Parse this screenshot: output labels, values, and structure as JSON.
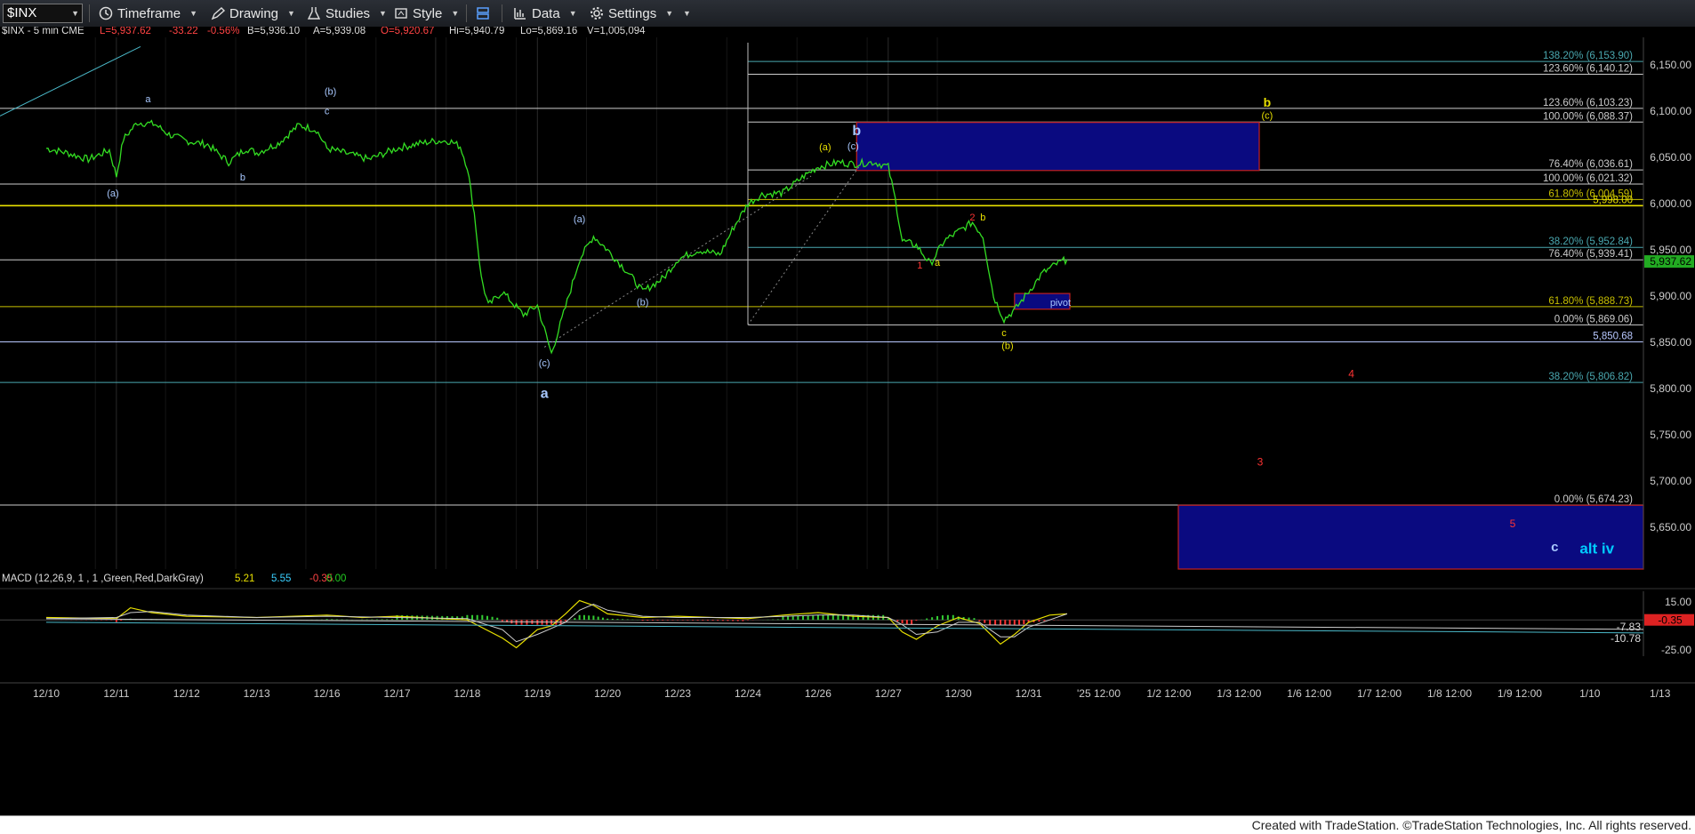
{
  "toolbar": {
    "symbol": "$INX",
    "timeframe": "Timeframe",
    "drawing": "Drawing",
    "studies": "Studies",
    "style": "Style",
    "data": "Data",
    "settings": "Settings"
  },
  "header": {
    "symbol_info": "$INX - 5 min  CME",
    "last": "L=5,937.62",
    "change": "-33.22",
    "change_pct": "-0.56%",
    "bid": "B=5,936.10",
    "ask": "A=5,939.08",
    "open": "O=5,920.67",
    "high": "Hi=5,940.79",
    "low": "Lo=5,869.16",
    "volume": "V=1,005,094"
  },
  "macd_header": {
    "label": "MACD (12,26,9, 1 , 1 ,Green,Red,DarkGray)",
    "v1": "5.21",
    "v2": "5.55",
    "v3": "-0.35",
    "v4": "0.00"
  },
  "footer": "Created with TradeStation. ©TradeStation Technologies, Inc. All rights reserved.",
  "colors": {
    "price_line": "#33dd22",
    "positive": "#33cc33",
    "negative": "#ff3333",
    "fib_yellow": "#e8e000",
    "wave_blue": "#a8c8ff",
    "box_blue": "#0a0a80",
    "box_border": "#c02020",
    "current_price_bg": "#22aa22"
  },
  "chart_data": {
    "type": "line",
    "title": "$INX - 5 min",
    "ylim": [
      5605,
      6180
    ],
    "y_ticks": [
      "6,150.00",
      "6,100.00",
      "6,050.00",
      "6,000.00",
      "5,950.00",
      "5,900.00",
      "5,850.00",
      "5,800.00",
      "5,750.00",
      "5,700.00",
      "5,650.00"
    ],
    "y_tick_values": [
      6150,
      6100,
      6050,
      6000,
      5950,
      5900,
      5850,
      5800,
      5750,
      5700,
      5650
    ],
    "x_ticks": [
      "12/10",
      "12/11",
      "12/12",
      "12/13",
      "12/16",
      "12/17",
      "12/18",
      "12/19",
      "12/20",
      "12/23",
      "12/24",
      "12/26",
      "12/27",
      "12/30",
      "12/31",
      "'25 12:00",
      "1/2 12:00",
      "1/3 12:00",
      "1/6 12:00",
      "1/7 12:00",
      "1/8 12:00",
      "1/9 12:00",
      "1/10",
      "1/13"
    ],
    "current_price": "5,937.62",
    "series": [
      {
        "values": [
          [
            0,
            6060
          ],
          [
            0.3,
            6055
          ],
          [
            0.6,
            6048
          ],
          [
            0.9,
            6058
          ],
          [
            1,
            6030
          ],
          [
            1.1,
            6070
          ],
          [
            1.3,
            6088
          ],
          [
            1.55,
            6086
          ],
          [
            1.75,
            6075
          ],
          [
            2,
            6068
          ],
          [
            2.3,
            6064
          ],
          [
            2.6,
            6045
          ],
          [
            2.85,
            6060
          ],
          [
            3,
            6055
          ],
          [
            3.3,
            6065
          ],
          [
            3.6,
            6085
          ],
          [
            3.85,
            6080
          ],
          [
            4,
            6060
          ],
          [
            4.3,
            6054
          ],
          [
            4.6,
            6048
          ],
          [
            5,
            6060
          ],
          [
            5.3,
            6065
          ],
          [
            5.55,
            6068
          ],
          [
            5.75,
            6068
          ],
          [
            5.9,
            6062
          ],
          [
            6,
            6040
          ],
          [
            6.1,
            5990
          ],
          [
            6.2,
            5920
          ],
          [
            6.3,
            5890
          ],
          [
            6.5,
            5905
          ],
          [
            6.8,
            5880
          ],
          [
            7,
            5890
          ],
          [
            7.2,
            5838
          ],
          [
            7.4,
            5888
          ],
          [
            7.6,
            5940
          ],
          [
            7.8,
            5965
          ],
          [
            8,
            5950
          ],
          [
            8.3,
            5925
          ],
          [
            8.5,
            5905
          ],
          [
            8.8,
            5920
          ],
          [
            9,
            5940
          ],
          [
            9.3,
            5950
          ],
          [
            9.6,
            5945
          ],
          [
            9.8,
            5975
          ],
          [
            10,
            6000
          ],
          [
            10.2,
            6010
          ],
          [
            10.5,
            6012
          ],
          [
            10.8,
            6030
          ],
          [
            11,
            6040
          ],
          [
            11.3,
            6045
          ],
          [
            11.5,
            6043
          ],
          [
            11.8,
            6045
          ],
          [
            12,
            6040
          ],
          [
            12.1,
            6005
          ],
          [
            12.2,
            5960
          ],
          [
            12.4,
            5955
          ],
          [
            12.6,
            5935
          ],
          [
            12.8,
            5960
          ],
          [
            13,
            5970
          ],
          [
            13.2,
            5980
          ],
          [
            13.35,
            5965
          ],
          [
            13.5,
            5900
          ],
          [
            13.65,
            5875
          ],
          [
            13.8,
            5885
          ],
          [
            14,
            5905
          ],
          [
            14.2,
            5925
          ],
          [
            14.4,
            5935
          ],
          [
            14.55,
            5940
          ]
        ]
      }
    ],
    "h_lines": [
      {
        "value": 6153.9,
        "label": "138.20% (6,153.90)",
        "color": "#4aa8b0"
      },
      {
        "value": 6140.12,
        "label": "123.60% (6,140.12)",
        "color": "#cccccc"
      },
      {
        "value": 6103.23,
        "label": "123.60% (6,103.23)",
        "color": "#cccccc"
      },
      {
        "value": 6088.37,
        "label": "100.00% (6,088.37)",
        "color": "#cccccc"
      },
      {
        "value": 6036.61,
        "label": "76.40% (6,036.61)",
        "color": "#cccccc"
      },
      {
        "value": 6021.32,
        "label": "100.00% (6,021.32)",
        "color": "#cccccc"
      },
      {
        "value": 6004.59,
        "label": "61.80% (6,004.59)",
        "color": "#c8c000"
      },
      {
        "value": 5998.0,
        "label": "5,998.00",
        "color": "#e8e000"
      },
      {
        "value": 5952.84,
        "label": "38.20% (5,952.84)",
        "color": "#4aa8b0"
      },
      {
        "value": 5939.41,
        "label": "76.40% (5,939.41)",
        "color": "#cccccc"
      },
      {
        "value": 5888.73,
        "label": "61.80% (5,888.73)",
        "color": "#c8c000"
      },
      {
        "value": 5869.06,
        "label": "0.00% (5,869.06)",
        "color": "#cccccc"
      },
      {
        "value": 5850.68,
        "label": "5,850.68",
        "color": "#b8c8ff"
      },
      {
        "value": 5806.82,
        "label": "38.20% (5,806.82)",
        "color": "#4aa8b0"
      },
      {
        "value": 5674.23,
        "label": "0.00% (5,674.23)",
        "color": "#cccccc"
      }
    ],
    "boxes": [
      {
        "label": "",
        "x_from": "12/26",
        "y_top": 6088,
        "y_bottom": 6036
      },
      {
        "label": "pivot",
        "x_from": "12/30",
        "y_top": 5903,
        "y_bottom": 5886
      },
      {
        "label": "",
        "x_from": "1/3 12:00",
        "y_top": 5674,
        "y_bottom": 5605
      }
    ],
    "wave_labels": [
      {
        "text": "a",
        "x": 1.45,
        "y": 6110,
        "color": "#a8c8ff",
        "size": 11
      },
      {
        "text": "(b)",
        "x": 4.05,
        "y": 6118,
        "color": "#a8c8ff",
        "size": 11
      },
      {
        "text": "c",
        "x": 4.0,
        "y": 6097,
        "color": "#a8c8ff",
        "size": 11
      },
      {
        "text": "(a)",
        "x": 0.95,
        "y": 6008,
        "color": "#a8c8ff",
        "size": 11
      },
      {
        "text": "b",
        "x": 2.8,
        "y": 6025,
        "color": "#a8c8ff",
        "size": 11
      },
      {
        "text": "(a)",
        "x": 7.6,
        "y": 5980,
        "color": "#a8c8ff",
        "size": 11
      },
      {
        "text": "(b)",
        "x": 8.5,
        "y": 5890,
        "color": "#a8c8ff",
        "size": 11
      },
      {
        "text": "(c)",
        "x": 7.1,
        "y": 5824,
        "color": "#a8c8ff",
        "size": 11
      },
      {
        "text": "a",
        "x": 7.1,
        "y": 5790,
        "color": "#a8c8ff",
        "size": 16,
        "bold": true
      },
      {
        "text": "(a)",
        "x": 11.1,
        "y": 6058,
        "color": "#e8e000",
        "size": 11
      },
      {
        "text": "(c)",
        "x": 11.5,
        "y": 6059,
        "color": "#a8c8ff",
        "size": 11
      },
      {
        "text": "b",
        "x": 11.55,
        "y": 6074,
        "color": "#a8c8ff",
        "size": 16,
        "bold": true
      },
      {
        "text": "2",
        "x": 13.2,
        "y": 5982,
        "color": "#ff3333",
        "size": 11
      },
      {
        "text": "b",
        "x": 13.35,
        "y": 5982,
        "color": "#e8e000",
        "size": 11
      },
      {
        "text": "1",
        "x": 12.45,
        "y": 5930,
        "color": "#ff3333",
        "size": 11
      },
      {
        "text": "a",
        "x": 12.7,
        "y": 5933,
        "color": "#e8e000",
        "size": 11
      },
      {
        "text": "c",
        "x": 13.65,
        "y": 5857,
        "color": "#e8e000",
        "size": 11
      },
      {
        "text": "(b)",
        "x": 13.7,
        "y": 5843,
        "color": "#e8e000",
        "size": 11
      },
      {
        "text": "b",
        "x": 17.4,
        "y": 6105,
        "color": "#e8e000",
        "size": 14,
        "bold": true
      },
      {
        "text": "(c)",
        "x": 17.4,
        "y": 6092,
        "color": "#e8e000",
        "size": 11
      },
      {
        "text": "4",
        "x": 18.6,
        "y": 5812,
        "color": "#ff3333",
        "size": 12
      },
      {
        "text": "3",
        "x": 17.3,
        "y": 5717,
        "color": "#ff3333",
        "size": 12
      },
      {
        "text": "5",
        "x": 20.9,
        "y": 5650,
        "color": "#ff3333",
        "size": 12
      },
      {
        "text": "c",
        "x": 21.5,
        "y": 5624,
        "color": "#a8c8ff",
        "size": 15,
        "bold": true
      },
      {
        "text": "alt iv",
        "x": 22.1,
        "y": 5622,
        "color": "#00ccff",
        "size": 17,
        "bold": true
      }
    ],
    "macd": {
      "ylim": [
        -30,
        20
      ],
      "y_ticks": [
        "15.00",
        "-25.00"
      ],
      "y_tick_values": [
        15,
        -25
      ],
      "labels": [
        {
          "text": "-7.83",
          "value": -7.83
        },
        {
          "text": "-10.78",
          "value": -10.78
        },
        {
          "text": "-0.35",
          "value": -0.35,
          "badge": true
        }
      ],
      "macd_line": [
        [
          0,
          2
        ],
        [
          1,
          1
        ],
        [
          1.2,
          10
        ],
        [
          1.5,
          6
        ],
        [
          2,
          3
        ],
        [
          3,
          2
        ],
        [
          4,
          4
        ],
        [
          4.5,
          2
        ],
        [
          5,
          3
        ],
        [
          6,
          0
        ],
        [
          6.5,
          -15
        ],
        [
          6.7,
          -23
        ],
        [
          7,
          -8
        ],
        [
          7.2,
          -5
        ],
        [
          7.4,
          5
        ],
        [
          7.6,
          16
        ],
        [
          7.8,
          12
        ],
        [
          8,
          5
        ],
        [
          8.5,
          2
        ],
        [
          9,
          3
        ],
        [
          10,
          1
        ],
        [
          10.5,
          4
        ],
        [
          11,
          6
        ],
        [
          11.5,
          3
        ],
        [
          12,
          2
        ],
        [
          12.2,
          -10
        ],
        [
          12.4,
          -16
        ],
        [
          12.7,
          -5
        ],
        [
          13,
          2
        ],
        [
          13.3,
          -3
        ],
        [
          13.6,
          -20
        ],
        [
          13.8,
          -12
        ],
        [
          14,
          -2
        ],
        [
          14.3,
          4
        ],
        [
          14.55,
          5
        ]
      ],
      "signal_line": [
        [
          0,
          1
        ],
        [
          1,
          2
        ],
        [
          1.2,
          6
        ],
        [
          1.5,
          7
        ],
        [
          2,
          4
        ],
        [
          3,
          2
        ],
        [
          4,
          3
        ],
        [
          5,
          2
        ],
        [
          6,
          1
        ],
        [
          6.5,
          -8
        ],
        [
          6.7,
          -18
        ],
        [
          7,
          -12
        ],
        [
          7.4,
          -2
        ],
        [
          7.6,
          8
        ],
        [
          7.8,
          13
        ],
        [
          8,
          8
        ],
        [
          8.5,
          3
        ],
        [
          9,
          2
        ],
        [
          10,
          2
        ],
        [
          11,
          4
        ],
        [
          11.5,
          4
        ],
        [
          12,
          2
        ],
        [
          12.2,
          -4
        ],
        [
          12.4,
          -12
        ],
        [
          12.7,
          -10
        ],
        [
          13,
          -2
        ],
        [
          13.3,
          -2
        ],
        [
          13.6,
          -14
        ],
        [
          13.8,
          -14
        ],
        [
          14,
          -6
        ],
        [
          14.3,
          0
        ],
        [
          14.55,
          5
        ]
      ],
      "trend_lines": [
        {
          "from": [
            0,
            -2
          ],
          "to": [
            24.2,
            -10.78
          ],
          "color": "#4ab8c8"
        },
        {
          "from": [
            0,
            1
          ],
          "to": [
            24.2,
            -7.83
          ],
          "color": "#cccccc"
        }
      ]
    }
  }
}
